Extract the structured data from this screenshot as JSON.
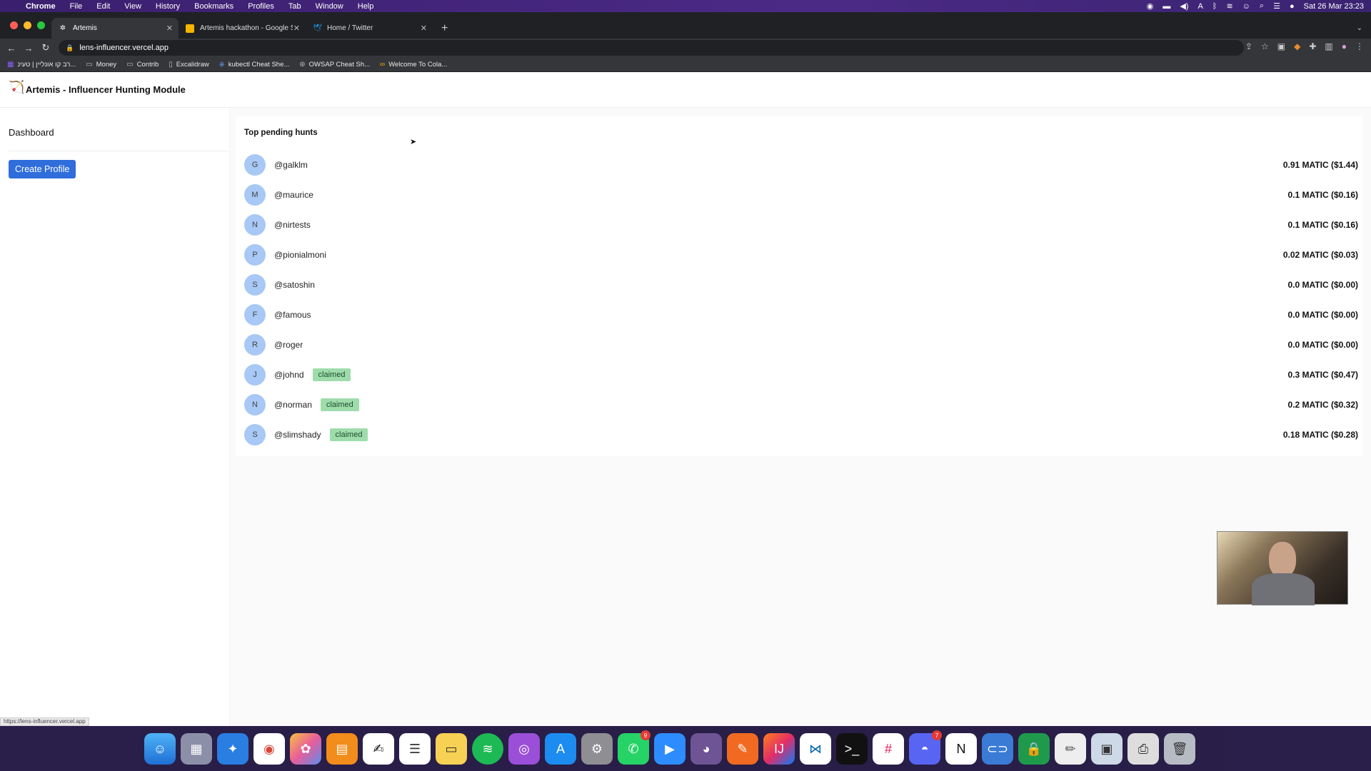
{
  "menubar": {
    "apple": "",
    "items": [
      "Chrome",
      "File",
      "Edit",
      "View",
      "History",
      "Bookmarks",
      "Profiles",
      "Tab",
      "Window",
      "Help"
    ],
    "datetime": "Sat 26 Mar  23:23"
  },
  "tabs": [
    {
      "label": "Artemis",
      "icon": "artemis-favicon"
    },
    {
      "label": "Artemis hackathon - Google Sl",
      "icon": "slides-favicon"
    },
    {
      "label": "Home / Twitter",
      "icon": "twitter-favicon"
    }
  ],
  "address": {
    "url": "lens-influencer.vercel.app"
  },
  "bookmarks": [
    {
      "label": "רב קו אונליין | טעינ...",
      "icon": "bookmark-icon"
    },
    {
      "label": "Money",
      "icon": "folder-icon"
    },
    {
      "label": "Contrib",
      "icon": "folder-icon"
    },
    {
      "label": "Excalidraw",
      "icon": "excalidraw-icon"
    },
    {
      "label": "kubectl Cheat She...",
      "icon": "kubernetes-icon"
    },
    {
      "label": "OWSAP Cheat Sh...",
      "icon": "owasp-icon"
    },
    {
      "label": "Welcome To Cola...",
      "icon": "colab-icon"
    }
  ],
  "app": {
    "title": "Artemis - Influencer Hunting Module",
    "sidebar": {
      "dashboard": "Dashboard",
      "create_button": "Create Profile"
    },
    "hunts": {
      "title": "Top pending hunts",
      "rows": [
        {
          "initial": "G",
          "handle": "@galklm",
          "claimed": false,
          "amount": "0.91 MATIC ($1.44)"
        },
        {
          "initial": "M",
          "handle": "@maurice",
          "claimed": false,
          "amount": "0.1 MATIC ($0.16)"
        },
        {
          "initial": "N",
          "handle": "@nirtests",
          "claimed": false,
          "amount": "0.1 MATIC ($0.16)"
        },
        {
          "initial": "P",
          "handle": "@pionialmoni",
          "claimed": false,
          "amount": "0.02 MATIC ($0.03)"
        },
        {
          "initial": "S",
          "handle": "@satoshin",
          "claimed": false,
          "amount": "0.0 MATIC ($0.00)"
        },
        {
          "initial": "F",
          "handle": "@famous",
          "claimed": false,
          "amount": "0.0 MATIC ($0.00)"
        },
        {
          "initial": "R",
          "handle": "@roger",
          "claimed": false,
          "amount": "0.0 MATIC ($0.00)"
        },
        {
          "initial": "J",
          "handle": "@johnd",
          "claimed": true,
          "amount": "0.3 MATIC ($0.47)"
        },
        {
          "initial": "N",
          "handle": "@norman",
          "claimed": true,
          "amount": "0.2 MATIC ($0.32)"
        },
        {
          "initial": "S",
          "handle": "@slimshady",
          "claimed": true,
          "amount": "0.18 MATIC ($0.28)"
        }
      ],
      "claimed_label": "claimed"
    }
  },
  "status_url": "https://lens-influencer.vercel.app",
  "dock_badges": {
    "whatsapp": "9",
    "discord": "7"
  },
  "colors": {
    "accent": "#2f6ddb",
    "avatar": "#a8c8f5",
    "claimed": "#9edcac"
  }
}
